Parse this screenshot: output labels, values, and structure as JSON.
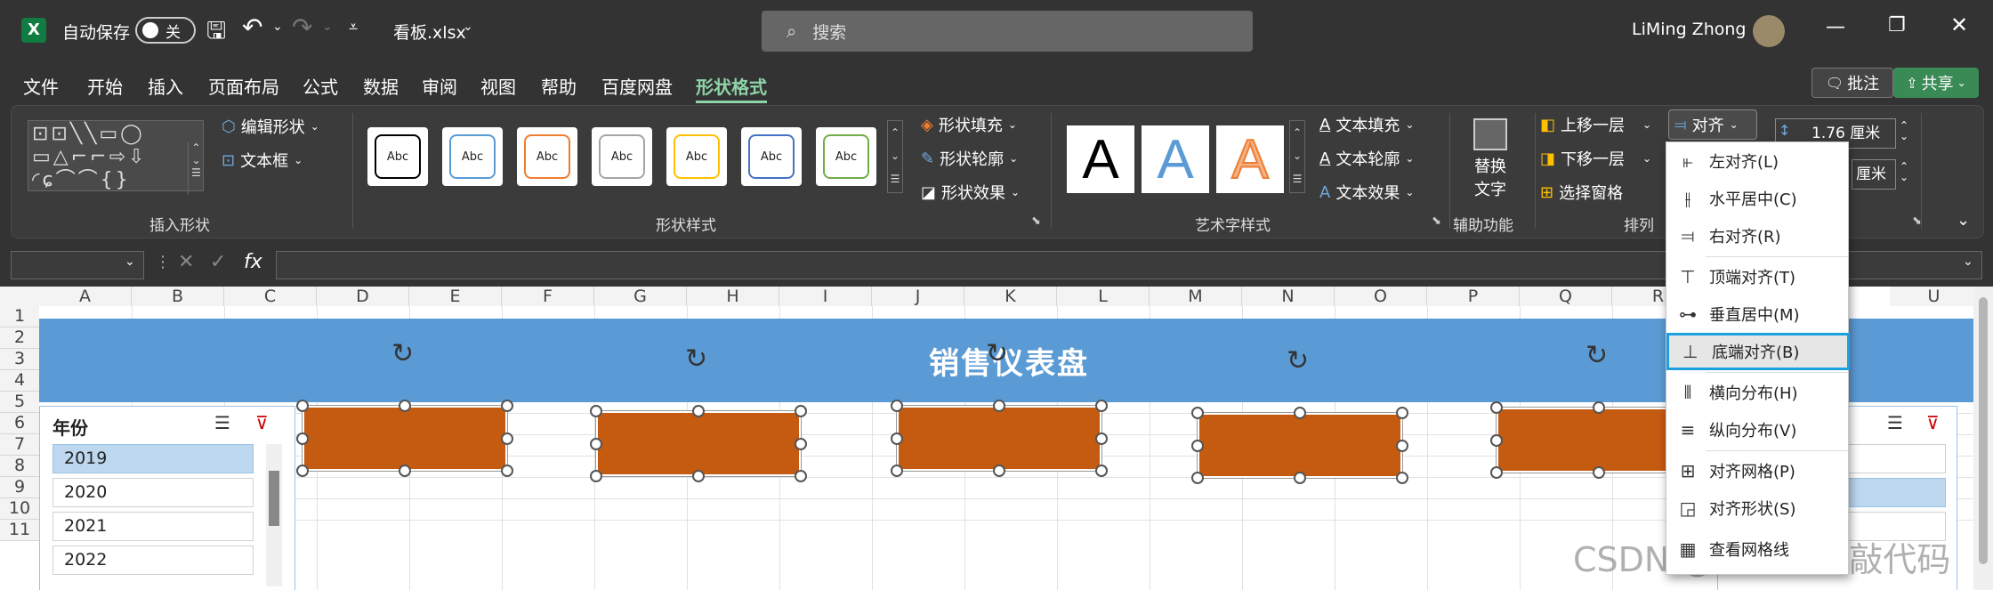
{
  "titlebar": {
    "autosave_label": "自动保存",
    "autosave_state": "关",
    "filename": "看板.xlsx",
    "search_placeholder": "搜索",
    "user_name": "LiMing Zhong"
  },
  "menu": [
    "文件",
    "开始",
    "插入",
    "页面布局",
    "公式",
    "数据",
    "审阅",
    "视图",
    "帮助",
    "百度网盘",
    "形状格式"
  ],
  "menu_right": {
    "comment": "批注",
    "share": "共享"
  },
  "ribbon": {
    "insert_shapes": {
      "edit_shape": "编辑形状",
      "textbox": "文本框",
      "group_label": "插入形状"
    },
    "shape_styles": {
      "sample_text": "Abc",
      "fill": "形状填充",
      "outline": "形状轮廓",
      "effect": "形状效果",
      "group_label": "形状样式"
    },
    "wordart": {
      "sample": "A",
      "text_fill": "文本填充",
      "text_outline": "文本轮廓",
      "text_effect": "文本效果",
      "group_label": "艺术字样式"
    },
    "accessibility": {
      "alt_text_line1": "替换",
      "alt_text_line2": "文字",
      "group_label": "辅助功能"
    },
    "arrange": {
      "bring_forward": "上移一层",
      "send_backward": "下移一层",
      "selection_pane": "选择窗格",
      "align": "对齐",
      "group_label": "排列"
    },
    "size": {
      "height": "1.76 厘米",
      "width_unit": "厘米"
    }
  },
  "formula": {
    "fx": "fx"
  },
  "columns": [
    "A",
    "B",
    "C",
    "D",
    "E",
    "F",
    "G",
    "H",
    "I",
    "J",
    "K",
    "L",
    "M",
    "N",
    "O",
    "P",
    "Q",
    "R",
    "U"
  ],
  "rows": [
    "1",
    "2",
    "3",
    "4",
    "5",
    "6",
    "7",
    "8",
    "9",
    "10",
    "11"
  ],
  "banner_title": "销售仪表盘",
  "slicer": {
    "title": "年份",
    "items": [
      "2019",
      "2020",
      "2021",
      "2022"
    ]
  },
  "align_menu": [
    {
      "label": "左对齐(L)",
      "icon": "align-left-icon"
    },
    {
      "label": "水平居中(C)",
      "icon": "align-center-icon"
    },
    {
      "label": "右对齐(R)",
      "icon": "align-right-icon"
    },
    {
      "label": "顶端对齐(T)",
      "icon": "align-top-icon"
    },
    {
      "label": "垂直居中(M)",
      "icon": "align-middle-icon"
    },
    {
      "label": "底端对齐(B)",
      "icon": "align-bottom-icon"
    },
    {
      "label": "横向分布(H)",
      "icon": "distribute-horizontal-icon"
    },
    {
      "label": "纵向分布(V)",
      "icon": "distribute-vertical-icon"
    },
    {
      "label": "对齐网格(P)",
      "icon": "snap-grid-icon"
    },
    {
      "label": "对齐形状(S)",
      "icon": "snap-shape-icon"
    },
    {
      "label": "查看网格线",
      "icon": "gridlines-icon"
    }
  ],
  "watermark": "CSDN @小钟不想敲代码",
  "colors": {
    "shape_fill": "#c55a11",
    "banner": "#5b9bd5",
    "accent": "#8fd3a8",
    "highlight_border": "#1ba1e2"
  }
}
